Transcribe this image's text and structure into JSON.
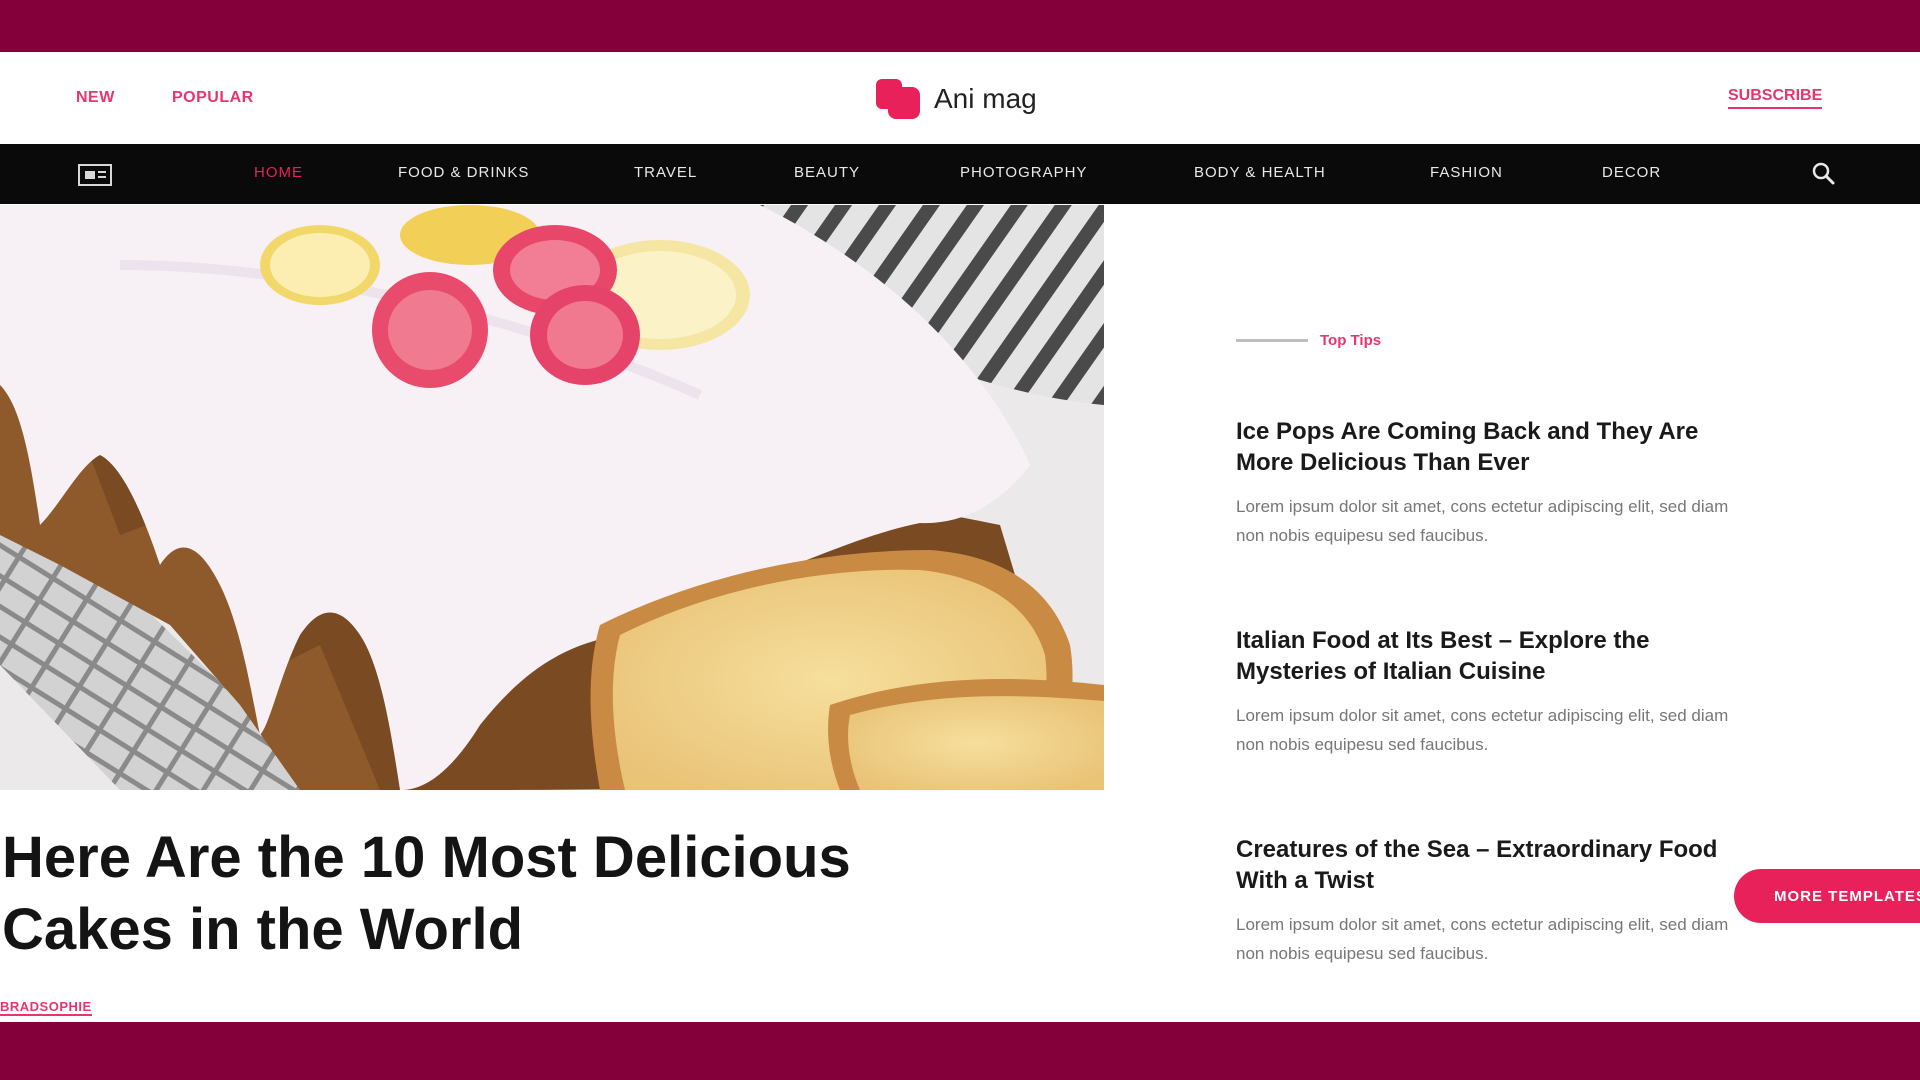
{
  "colors": {
    "frame": "#84003b",
    "accent": "#e8215a",
    "nav_bg": "#0a0a0a"
  },
  "header": {
    "links": [
      "NEW",
      "POPULAR"
    ],
    "logo_text": "Ani mag",
    "subscribe_label": "SUBSCRIBE"
  },
  "nav": {
    "menu_icon": "layout-icon",
    "items": [
      "HOME",
      "FOOD & DRINKS",
      "TRAVEL",
      "BEAUTY",
      "PHOTOGRAPHY",
      "BODY & HEALTH",
      "FASHION",
      "DECOR"
    ],
    "active_index": 0,
    "search_icon": "search-icon"
  },
  "hero": {
    "image": "iced-lemon-loaf-cake-with-strawberries",
    "title": "Here Are the 10 Most Delicious Cakes in the World",
    "author": "BRADSOPHIE"
  },
  "sidebar": {
    "section_label": "Top Tips",
    "articles": [
      {
        "title": "Ice Pops Are Coming Back and They Are More Delicious Than Ever",
        "excerpt": "Lorem ipsum dolor sit amet, cons ectetur adipiscing elit, sed diam non nobis equipesu sed faucibus."
      },
      {
        "title": "Italian Food at Its Best – Explore the Mysteries of Italian Cuisine",
        "excerpt": "Lorem ipsum dolor sit amet, cons ectetur adipiscing elit, sed diam non nobis equipesu sed faucibus."
      },
      {
        "title": "Creatures of the Sea – Extraordinary Food With a Twist",
        "excerpt": "Lorem ipsum dolor sit amet, cons ectetur adipiscing elit, sed diam non nobis equipesu sed faucibus."
      }
    ]
  },
  "more_templates_label": "MORE TEMPLATES"
}
